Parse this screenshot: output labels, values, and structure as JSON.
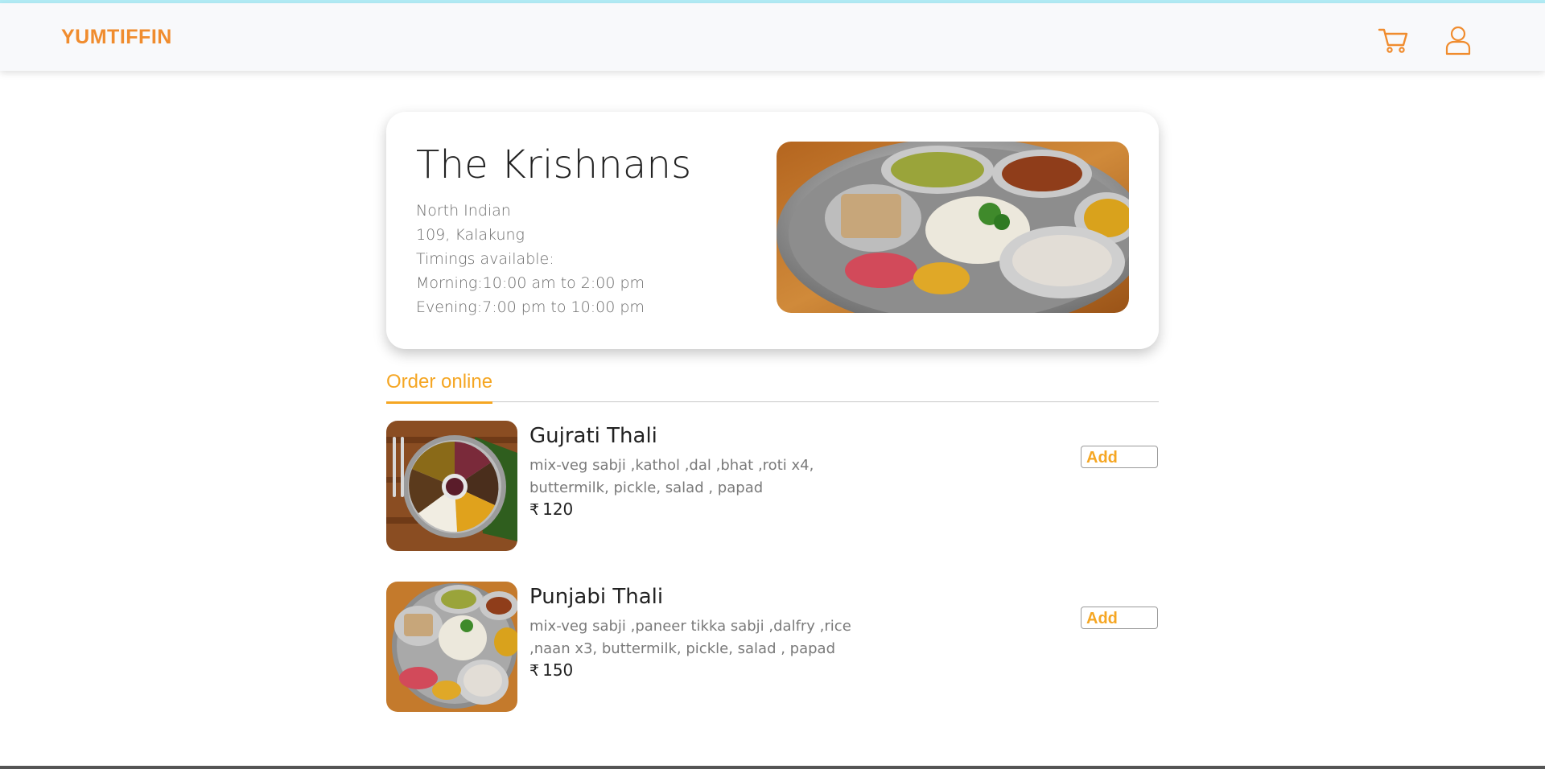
{
  "navbar": {
    "brand": "YUMTIFFIN",
    "icons": [
      "cart-icon",
      "user-icon"
    ],
    "accent_color": "#f08c2e"
  },
  "restaurant": {
    "name": "The Krishnans",
    "cuisine": "North Indian",
    "address": "109, Kalakung",
    "timings_label": "Timings available:",
    "morning": "Morning:10:00 am to 2:00 pm",
    "evening": "Evening:7:00 pm to 10:00 pm"
  },
  "tabs": {
    "active_label": "Order online",
    "active_color": "#f5a623"
  },
  "menu": {
    "currency_symbol": "₹",
    "items": [
      {
        "title": "Gujrati Thali",
        "description": "mix-veg sabji ,kathol ,dal ,bhat ,roti x4, buttermilk, pickle, salad , papad",
        "price": "120",
        "add_label": "Add"
      },
      {
        "title": "Punjabi Thali",
        "description": "mix-veg sabji ,paneer tikka sabji ,dalfry ,rice ,naan x3, buttermilk, pickle, salad , papad",
        "price": "150",
        "add_label": "Add"
      }
    ]
  }
}
